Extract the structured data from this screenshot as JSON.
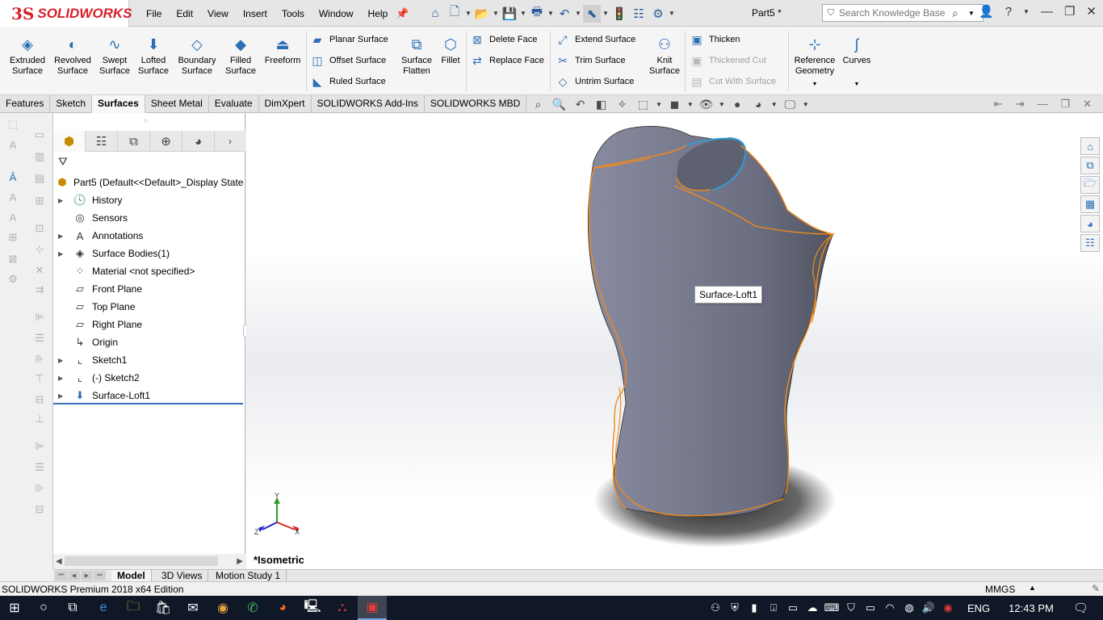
{
  "app": {
    "logo_text": "SOLIDWORKS",
    "doc_title": "Part5 *",
    "menu": [
      "File",
      "Edit",
      "View",
      "Insert",
      "Tools",
      "Window",
      "Help"
    ]
  },
  "search": {
    "placeholder": "Search Knowledge Base"
  },
  "ribbon": {
    "big_buttons": [
      {
        "line1": "Extruded",
        "line2": "Surface",
        "icon": "extruded-surface-icon"
      },
      {
        "line1": "Revolved",
        "line2": "Surface",
        "icon": "revolved-surface-icon"
      },
      {
        "line1": "Swept",
        "line2": "Surface",
        "icon": "swept-surface-icon"
      },
      {
        "line1": "Lofted",
        "line2": "Surface",
        "icon": "lofted-surface-icon"
      },
      {
        "line1": "Boundary",
        "line2": "Surface",
        "icon": "boundary-surface-icon"
      },
      {
        "line1": "Filled",
        "line2": "Surface",
        "icon": "filled-surface-icon"
      },
      {
        "line1": "Freeform",
        "line2": "",
        "icon": "freeform-icon"
      }
    ],
    "col_planar": [
      "Planar Surface",
      "Offset Surface",
      "Ruled Surface"
    ],
    "surface_flatten": {
      "line1": "Surface",
      "line2": "Flatten"
    },
    "fillet": "Fillet",
    "col_face": [
      "Delete Face",
      "Replace Face"
    ],
    "col_extend": [
      "Extend Surface",
      "Trim Surface",
      "Untrim Surface"
    ],
    "knit": {
      "line1": "Knit",
      "line2": "Surface"
    },
    "col_thicken": [
      "Thicken",
      "Thickened Cut",
      "Cut With Surface"
    ],
    "reference": {
      "line1": "Reference",
      "line2": "Geometry"
    },
    "curves": "Curves"
  },
  "tabs": [
    "Features",
    "Sketch",
    "Surfaces",
    "Sheet Metal",
    "Evaluate",
    "DimXpert",
    "SOLIDWORKS Add-Ins",
    "SOLIDWORKS MBD"
  ],
  "active_tab": "Surfaces",
  "tree": {
    "root": "Part5  (Default<<Default>_Display State",
    "items": [
      {
        "label": "History",
        "expand": true,
        "icon": "history-icon"
      },
      {
        "label": "Sensors",
        "expand": false,
        "icon": "sensors-icon"
      },
      {
        "label": "Annotations",
        "expand": true,
        "icon": "annotations-icon"
      },
      {
        "label": "Surface Bodies(1)",
        "expand": true,
        "icon": "surface-bodies-icon"
      },
      {
        "label": "Material <not specified>",
        "expand": false,
        "icon": "material-icon"
      },
      {
        "label": "Front Plane",
        "expand": false,
        "icon": "plane-icon"
      },
      {
        "label": "Top Plane",
        "expand": false,
        "icon": "plane-icon"
      },
      {
        "label": "Right Plane",
        "expand": false,
        "icon": "plane-icon"
      },
      {
        "label": "Origin",
        "expand": false,
        "icon": "origin-icon"
      },
      {
        "label": "Sketch1",
        "expand": true,
        "icon": "sketch-icon"
      },
      {
        "label": "(-) Sketch2",
        "expand": true,
        "icon": "sketch-icon"
      },
      {
        "label": "Surface-Loft1",
        "expand": true,
        "icon": "loft-icon"
      }
    ]
  },
  "graphics": {
    "tooltip": "Surface-Loft1",
    "view_name": "*Isometric",
    "triad": {
      "x": "X",
      "y": "Y",
      "z": "Z"
    },
    "colors": {
      "body": "#6f7283",
      "edge": "#f08a1a",
      "selected_edge": "#2f9bd6"
    }
  },
  "bottom_tabs": [
    "Model",
    "3D Views",
    "Motion Study 1"
  ],
  "status": {
    "left": "SOLIDWORKS Premium 2018 x64 Edition",
    "units": "MMGS"
  },
  "taskbar": {
    "lang": "ENG",
    "time": "12:43 PM"
  }
}
